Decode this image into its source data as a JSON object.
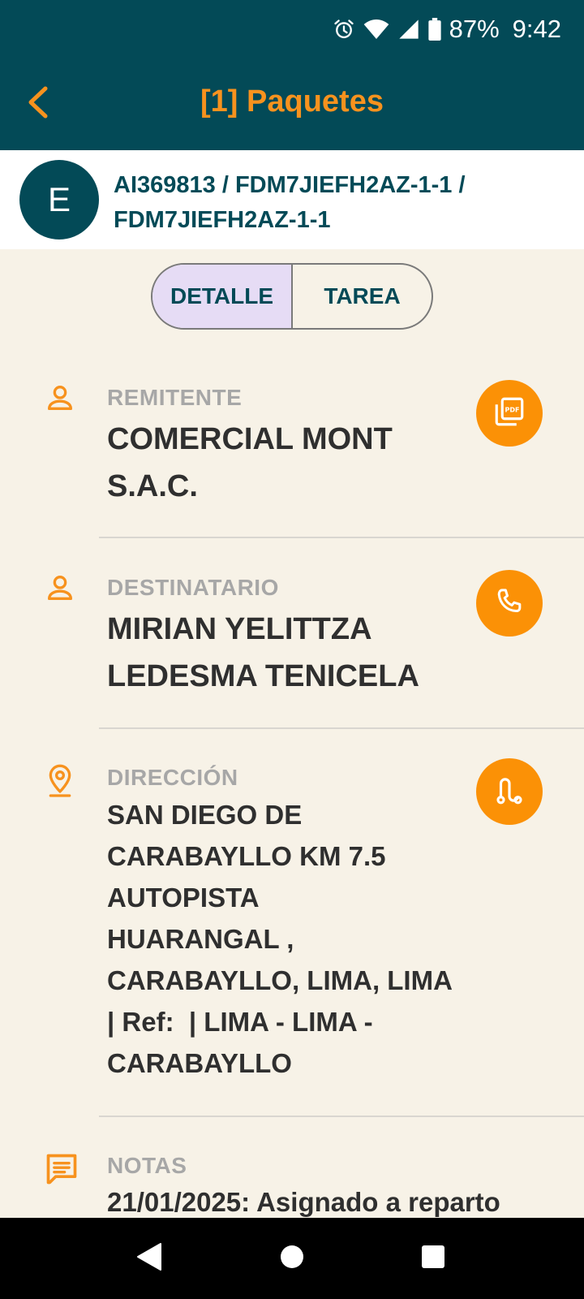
{
  "status_bar": {
    "battery": "87%",
    "time": "9:42"
  },
  "app_bar": {
    "title": "[1] Paquetes"
  },
  "header": {
    "avatar_letter": "E",
    "ids_line1": "AI369813 / FDM7JIEFH2AZ-1-1 /",
    "ids_line2": "FDM7JIEFH2AZ-1-1"
  },
  "tabs": [
    {
      "label": "DETALLE",
      "active": true
    },
    {
      "label": "TAREA",
      "active": false
    }
  ],
  "details": {
    "remitente": {
      "label": "REMITENTE",
      "value_lines": [
        "COMERCIAL MONT",
        "S.A.C."
      ],
      "icon": "person-icon",
      "action_icon": "pdf-icon"
    },
    "destinatario": {
      "label": "DESTINATARIO",
      "value_lines": [
        "MIRIAN YELITTZA",
        "LEDESMA TENICELA"
      ],
      "icon": "person-icon",
      "action_icon": "phone-icon"
    },
    "direccion": {
      "label": "DIRECCIÓN",
      "value_lines": [
        "SAN DIEGO DE",
        "CARABAYLLO KM 7.5",
        "AUTOPISTA",
        "HUARANGAL ,",
        "CARABAYLLO, LIMA, LIMA",
        "| Ref:  | LIMA - LIMA -",
        "CARABAYLLO"
      ],
      "icon": "location-pin-icon",
      "action_icon": "route-icon"
    },
    "notas": {
      "label": "NOTAS",
      "value": "21/01/2025: Asignado a reparto",
      "icon": "notes-icon"
    }
  },
  "colors": {
    "primary": "#034a57",
    "accent": "#f7921e",
    "action": "#fb9106",
    "background": "#f7f2e7",
    "tab_active": "#e6dcf5"
  }
}
